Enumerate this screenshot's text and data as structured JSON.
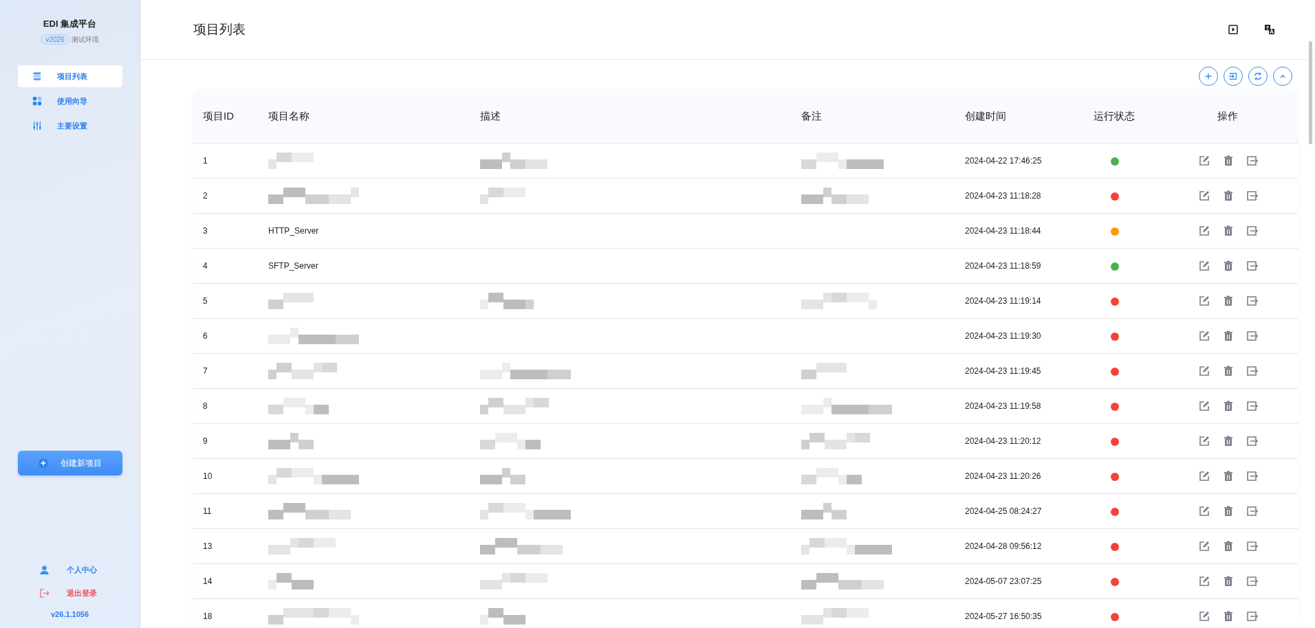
{
  "sidebar": {
    "brand": "EDI 集成平台",
    "version_badge": "v2026",
    "environment": "测试环境",
    "nav": [
      {
        "label": "项目列表",
        "selected": true
      },
      {
        "label": "使用向导",
        "selected": false
      },
      {
        "label": "主要设置",
        "selected": false
      }
    ],
    "create_button": "创建新项目",
    "profile": "个人中心",
    "logout": "退出登录",
    "build": "v26.1.1056"
  },
  "header": {
    "title": "项目列表"
  },
  "table": {
    "columns": [
      "项目ID",
      "项目名称",
      "描述",
      "备注",
      "创建时间",
      "运行状态",
      "操作"
    ],
    "rows": [
      {
        "id": "1",
        "name": {
          "kind": "blurred"
        },
        "description": {
          "kind": "blurred"
        },
        "note": {
          "kind": "blurred"
        },
        "created": "2024-04-22 17:46:25",
        "color": "#4caf50"
      },
      {
        "id": "2",
        "name": {
          "kind": "blurred"
        },
        "description": {
          "kind": "blurred"
        },
        "note": {
          "kind": "blurred"
        },
        "created": "2024-04-23 11:18:28",
        "color": "#f44336"
      },
      {
        "id": "3",
        "name": {
          "kind": "text",
          "text": "HTTP_Server"
        },
        "description": {
          "kind": "empty"
        },
        "note": {
          "kind": "empty"
        },
        "created": "2024-04-23 11:18:44",
        "color": "#ff9800"
      },
      {
        "id": "4",
        "name": {
          "kind": "text",
          "text": "SFTP_Server"
        },
        "description": {
          "kind": "empty"
        },
        "note": {
          "kind": "empty"
        },
        "created": "2024-04-23 11:18:59",
        "color": "#4caf50"
      },
      {
        "id": "5",
        "name": {
          "kind": "blurred"
        },
        "description": {
          "kind": "blurred"
        },
        "note": {
          "kind": "blurred"
        },
        "created": "2024-04-23 11:19:14",
        "color": "#f44336"
      },
      {
        "id": "6",
        "name": {
          "kind": "blurred"
        },
        "description": {
          "kind": "empty"
        },
        "note": {
          "kind": "empty"
        },
        "created": "2024-04-23 11:19:30",
        "color": "#f44336"
      },
      {
        "id": "7",
        "name": {
          "kind": "blurred"
        },
        "description": {
          "kind": "blurred"
        },
        "note": {
          "kind": "blurred"
        },
        "created": "2024-04-23 11:19:45",
        "color": "#f44336"
      },
      {
        "id": "8",
        "name": {
          "kind": "blurred"
        },
        "description": {
          "kind": "blurred"
        },
        "note": {
          "kind": "blurred"
        },
        "created": "2024-04-23 11:19:58",
        "color": "#f44336"
      },
      {
        "id": "9",
        "name": {
          "kind": "blurred"
        },
        "description": {
          "kind": "blurred"
        },
        "note": {
          "kind": "blurred"
        },
        "created": "2024-04-23 11:20:12",
        "color": "#f44336"
      },
      {
        "id": "10",
        "name": {
          "kind": "blurred"
        },
        "description": {
          "kind": "blurred"
        },
        "note": {
          "kind": "blurred"
        },
        "created": "2024-04-23 11:20:26",
        "color": "#f44336"
      },
      {
        "id": "11",
        "name": {
          "kind": "blurred"
        },
        "description": {
          "kind": "blurred"
        },
        "note": {
          "kind": "blurred"
        },
        "created": "2024-04-25 08:24:27",
        "color": "#f44336"
      },
      {
        "id": "13",
        "name": {
          "kind": "blurred"
        },
        "description": {
          "kind": "blurred"
        },
        "note": {
          "kind": "blurred"
        },
        "created": "2024-04-28 09:56:12",
        "color": "#f44336"
      },
      {
        "id": "14",
        "name": {
          "kind": "blurred"
        },
        "description": {
          "kind": "blurred"
        },
        "note": {
          "kind": "blurred"
        },
        "created": "2024-05-07 23:07:25",
        "color": "#f44336"
      },
      {
        "id": "18",
        "name": {
          "kind": "blurred"
        },
        "description": {
          "kind": "blurred"
        },
        "note": {
          "kind": "blurred"
        },
        "created": "2024-05-27 16:50:35",
        "color": "#f44336"
      }
    ]
  }
}
